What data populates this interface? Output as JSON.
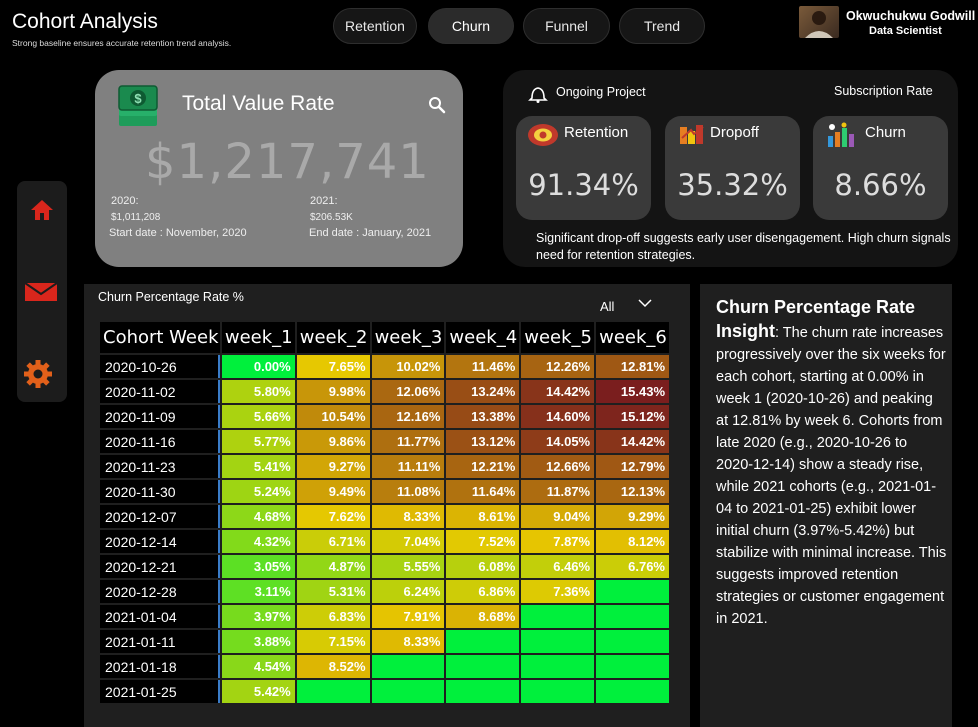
{
  "header": {
    "title": "Cohort Analysis",
    "subtitle": "Strong  baseline ensures accurate retention trend analysis."
  },
  "nav": {
    "tabs": [
      {
        "label": "Retention"
      },
      {
        "label": "Churn",
        "active": true
      },
      {
        "label": "Funnel"
      },
      {
        "label": "Trend"
      }
    ]
  },
  "user": {
    "name": "Okwuchukwu Godwill",
    "role": "Data Scientist"
  },
  "value_card": {
    "title": "Total Value Rate",
    "amount": "$1,217,741",
    "y2020_label": "2020:",
    "y2020_value": "$1,011,208",
    "start": "Start date : November, 2020",
    "y2021_label": "2021:",
    "y2021_value": "$206.53K",
    "end": "End date : January, 2021"
  },
  "rate_panel": {
    "ongoing_label": "Ongoing Project",
    "subscription_label": "Subscription Rate",
    "kpis": [
      {
        "label": "Retention",
        "value": "91.34%",
        "icon": "retention-icon"
      },
      {
        "label": "Dropoff",
        "value": "35.32%",
        "icon": "dropoff-icon"
      },
      {
        "label": "Churn",
        "value": "8.66%",
        "icon": "churn-icon"
      }
    ],
    "note": "Significant drop-off suggests early user disengagement. High churn signals need for retention strategies."
  },
  "sidebar": {
    "icons": [
      "home-icon",
      "mail-icon",
      "gear-icon"
    ]
  },
  "table": {
    "title": "Churn Percentage Rate %",
    "filter": "All",
    "headers": [
      "Cohort Week",
      "week_1",
      "week_2",
      "week_3",
      "week_4",
      "week_5",
      "week_6"
    ],
    "rows": [
      {
        "cohort": "2020-10-26",
        "values": [
          "0.00%",
          "7.65%",
          "10.02%",
          "11.46%",
          "12.26%",
          "12.81%"
        ]
      },
      {
        "cohort": "2020-11-02",
        "values": [
          "5.80%",
          "9.98%",
          "12.06%",
          "13.24%",
          "14.42%",
          "15.43%"
        ]
      },
      {
        "cohort": "2020-11-09",
        "values": [
          "5.66%",
          "10.54%",
          "12.16%",
          "13.38%",
          "14.60%",
          "15.12%"
        ]
      },
      {
        "cohort": "2020-11-16",
        "values": [
          "5.77%",
          "9.86%",
          "11.77%",
          "13.12%",
          "14.05%",
          "14.42%"
        ]
      },
      {
        "cohort": "2020-11-23",
        "values": [
          "5.41%",
          "9.27%",
          "11.11%",
          "12.21%",
          "12.66%",
          "12.79%"
        ]
      },
      {
        "cohort": "2020-11-30",
        "values": [
          "5.24%",
          "9.49%",
          "11.08%",
          "11.64%",
          "11.87%",
          "12.13%"
        ]
      },
      {
        "cohort": "2020-12-07",
        "values": [
          "4.68%",
          "7.62%",
          "8.33%",
          "8.61%",
          "9.04%",
          "9.29%"
        ]
      },
      {
        "cohort": "2020-12-14",
        "values": [
          "4.32%",
          "6.71%",
          "7.04%",
          "7.52%",
          "7.87%",
          "8.12%"
        ]
      },
      {
        "cohort": "2020-12-21",
        "values": [
          "3.05%",
          "4.87%",
          "5.55%",
          "6.08%",
          "6.46%",
          "6.76%"
        ]
      },
      {
        "cohort": "2020-12-28",
        "values": [
          "3.11%",
          "5.31%",
          "6.24%",
          "6.86%",
          "7.36%",
          ""
        ]
      },
      {
        "cohort": "2021-01-04",
        "values": [
          "3.97%",
          "6.83%",
          "7.91%",
          "8.68%",
          "",
          ""
        ]
      },
      {
        "cohort": "2021-01-11",
        "values": [
          "3.88%",
          "7.15%",
          "8.33%",
          "",
          "",
          ""
        ]
      },
      {
        "cohort": "2021-01-18",
        "values": [
          "4.54%",
          "8.52%",
          "",
          "",
          "",
          ""
        ]
      },
      {
        "cohort": "2021-01-25",
        "values": [
          "5.42%",
          "",
          "",
          "",
          "",
          ""
        ]
      }
    ]
  },
  "insight": {
    "heading": "Churn Percentage Rate Insight",
    "body": ": The churn rate increases progressively over the six weeks for each cohort, starting at 0.00% in week 1 (2020-10-26) and peaking at 12.81% by week 6. Cohorts from late 2020 (e.g., 2020-10-26 to 2020-12-14) show a steady rise, while 2021 cohorts (e.g., 2021-01-04 to 2021-01-25) exhibit lower initial churn (3.97%-5.42%) but stabilize with minimal increase. This suggests improved retention strategies or customer engagement in 2021."
  },
  "colors": {
    "empty_cell": "#00f03c",
    "low": "#00f03c",
    "mid": "#e8c800",
    "high": "#7a1e1e"
  }
}
